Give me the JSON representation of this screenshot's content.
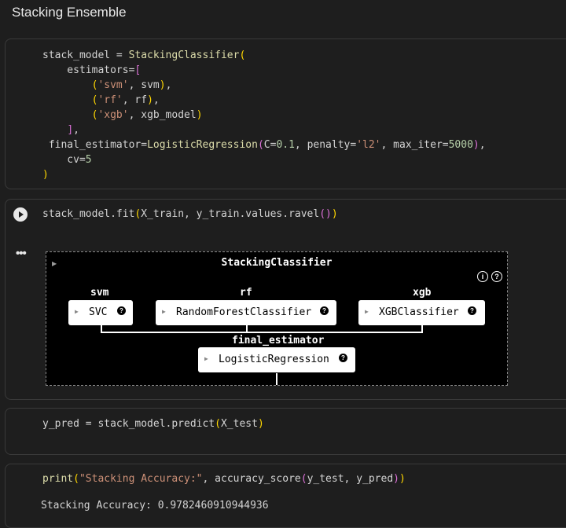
{
  "heading": "Stacking Ensemble",
  "cell1": {
    "lines": [
      [
        [
          "plain",
          "stack_model = "
        ],
        [
          "fn",
          "StackingClassifier"
        ],
        [
          "p1",
          "("
        ]
      ],
      [
        [
          "plain",
          "    estimators="
        ],
        [
          "p2",
          "["
        ]
      ],
      [
        [
          "plain",
          "        "
        ],
        [
          "p1",
          "("
        ],
        [
          "str",
          "'svm'"
        ],
        [
          "plain",
          ", svm"
        ],
        [
          "p1",
          ")"
        ],
        [
          "plain",
          ","
        ]
      ],
      [
        [
          "plain",
          "        "
        ],
        [
          "p1",
          "("
        ],
        [
          "str",
          "'rf'"
        ],
        [
          "plain",
          ", rf"
        ],
        [
          "p1",
          ")"
        ],
        [
          "plain",
          ","
        ]
      ],
      [
        [
          "plain",
          "        "
        ],
        [
          "p1",
          "("
        ],
        [
          "str",
          "'xgb'"
        ],
        [
          "plain",
          ", xgb_model"
        ],
        [
          "p1",
          ")"
        ]
      ],
      [
        [
          "plain",
          "    "
        ],
        [
          "p2",
          "]"
        ],
        [
          "plain",
          ","
        ]
      ],
      [
        [
          "plain",
          " final_estimator="
        ],
        [
          "fn",
          "LogisticRegression"
        ],
        [
          "p2",
          "("
        ],
        [
          "plain",
          "C="
        ],
        [
          "num",
          "0.1"
        ],
        [
          "plain",
          ", penalty="
        ],
        [
          "str",
          "'l2'"
        ],
        [
          "plain",
          ", max_iter="
        ],
        [
          "num",
          "5000"
        ],
        [
          "p2",
          ")"
        ],
        [
          "plain",
          ","
        ]
      ],
      [
        [
          "plain",
          "    cv="
        ],
        [
          "num",
          "5"
        ]
      ],
      [
        [
          "p1",
          ")"
        ]
      ]
    ]
  },
  "cell2": {
    "lines": [
      [
        [
          "plain",
          "stack_model.fit"
        ],
        [
          "p1",
          "("
        ],
        [
          "plain",
          "X_train, y_train.values.ravel"
        ],
        [
          "p2",
          "("
        ],
        [
          "p2",
          ")"
        ],
        [
          "p1",
          ")"
        ]
      ]
    ]
  },
  "cell3": {
    "lines": [
      [
        [
          "plain",
          "y_pred = stack_model.predict"
        ],
        [
          "p1",
          "("
        ],
        [
          "plain",
          "X_test"
        ],
        [
          "p1",
          ")"
        ]
      ]
    ]
  },
  "cell4": {
    "lines": [
      [
        [
          "fn",
          "print"
        ],
        [
          "p1",
          "("
        ],
        [
          "str",
          "\"Stacking Accuracy:\""
        ],
        [
          "plain",
          ", accuracy_score"
        ],
        [
          "p2",
          "("
        ],
        [
          "plain",
          "y_test, y_pred"
        ],
        [
          "p2",
          ")"
        ],
        [
          "p1",
          ")"
        ]
      ]
    ]
  },
  "diagram": {
    "title": "StackingClassifier",
    "info_icon": "i",
    "help_icon": "?",
    "estimators": [
      {
        "name": "svm",
        "model": "SVC"
      },
      {
        "name": "rf",
        "model": "RandomForestClassifier"
      },
      {
        "name": "xgb",
        "model": "XGBClassifier"
      }
    ],
    "final_label": "final_estimator",
    "final_model": "LogisticRegression",
    "box_help": "?"
  },
  "output": "Stacking Accuracy: 0.9782460910944936",
  "colors": {
    "function": "#dcdcaa",
    "string": "#ce9178",
    "number": "#b5cea8",
    "bracket1": "#ffd700",
    "bracket2": "#da70d6"
  }
}
